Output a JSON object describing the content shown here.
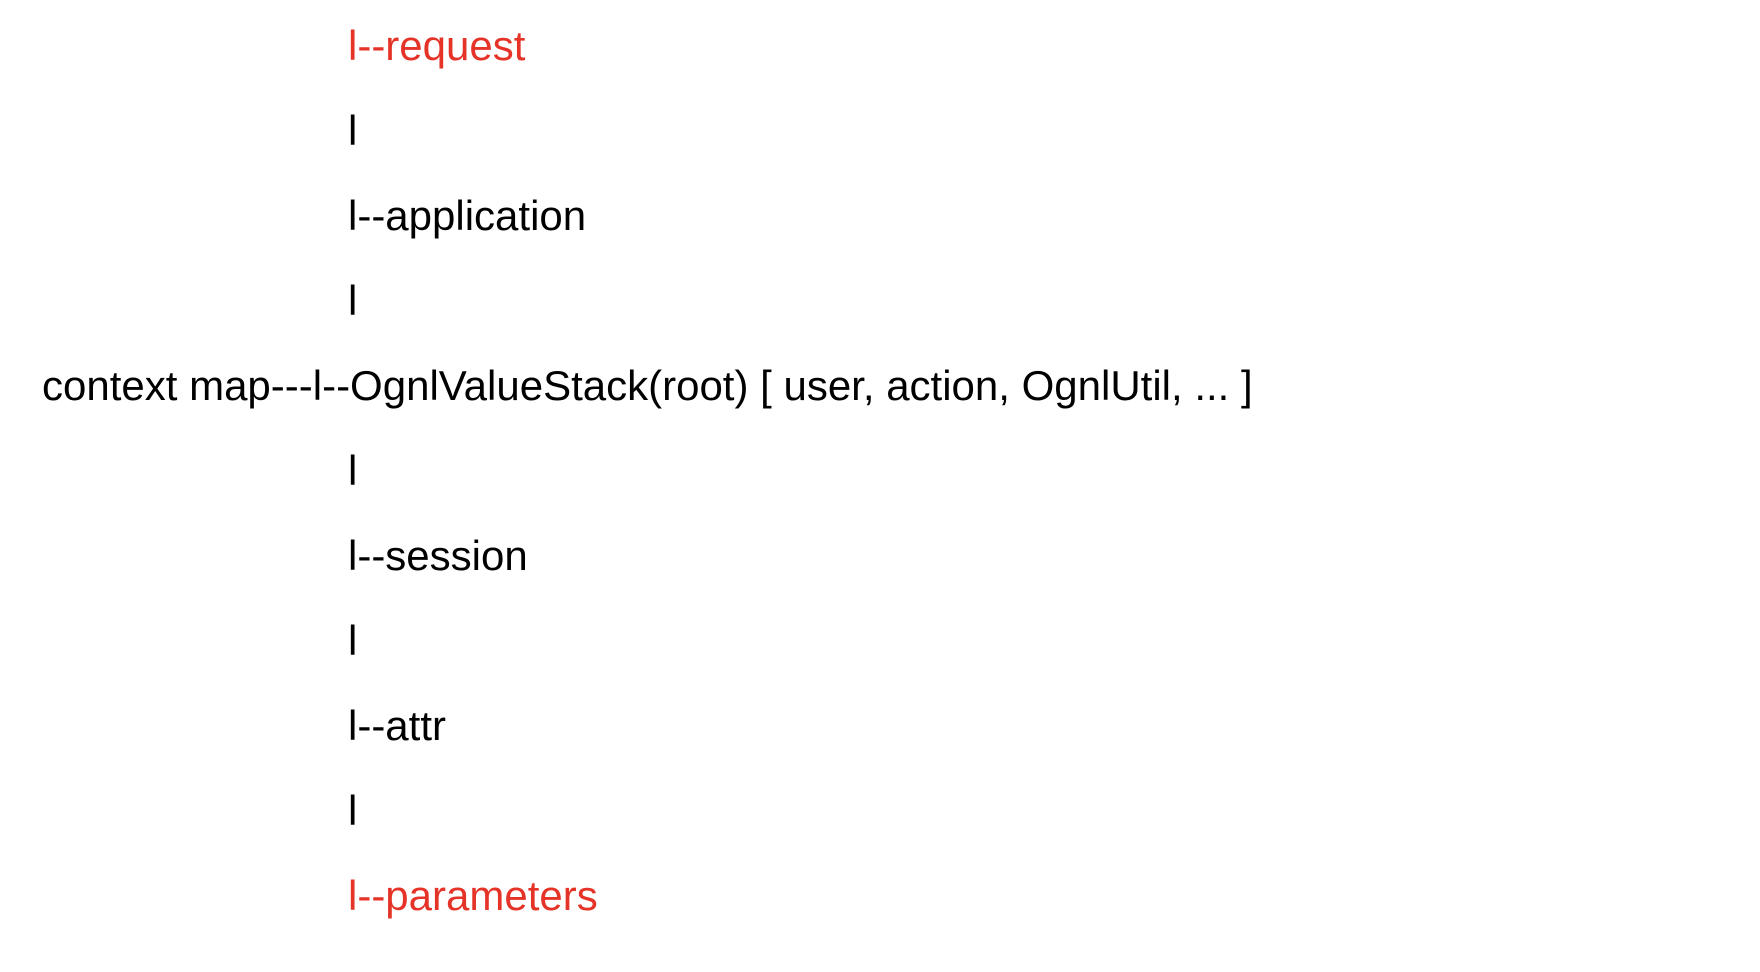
{
  "colors": {
    "text": "#000000",
    "highlight": "#e53328",
    "background": "#ffffff"
  },
  "lines": {
    "request": "l--request",
    "bar1": "l",
    "application": "l--application",
    "bar2": "l",
    "root_prefix": "context map---",
    "root_main": "l--OgnlValueStack(root) [ user, action, OgnlUtil, ... ]",
    "bar3": "l",
    "session": "l--session",
    "bar4": "l",
    "attr": "l--attr",
    "bar5": "l",
    "parameters": "l--parameters"
  }
}
